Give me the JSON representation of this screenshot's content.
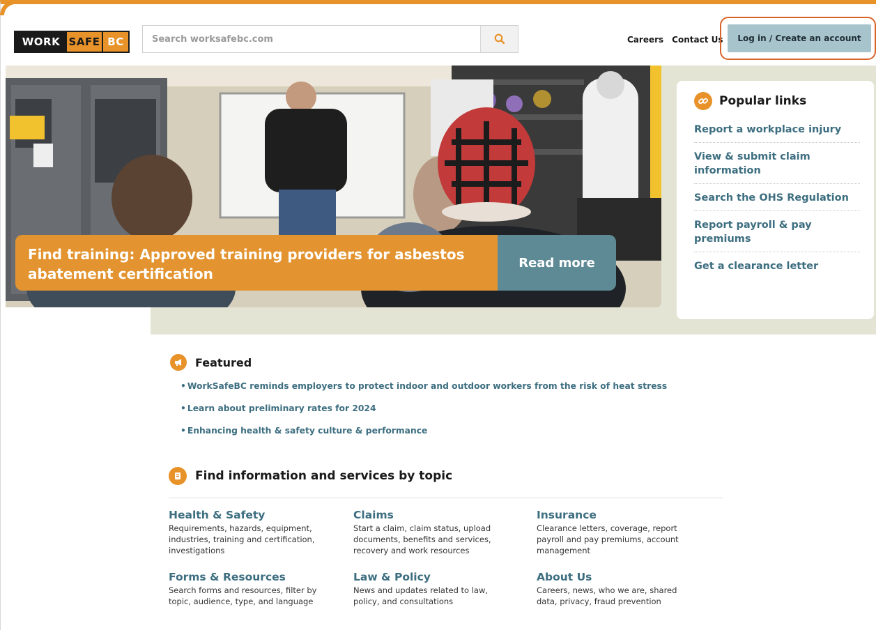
{
  "header": {
    "logo": {
      "work": "WORK",
      "safe": "SAFE",
      "bc": "BC"
    },
    "search_placeholder": "Search worksafebc.com",
    "links": [
      "Careers",
      "Contact Us"
    ],
    "login_label": "Log in / Create an account"
  },
  "hero": {
    "caption": "Find training: Approved training providers for asbestos abatement certification",
    "read_more": "Read more"
  },
  "popular": {
    "title": "Popular links",
    "items": [
      "Report a workplace injury",
      "View & submit claim information",
      "Search the OHS Regulation",
      "Report payroll & pay premiums",
      "Get a clearance letter"
    ]
  },
  "featured": {
    "title": "Featured",
    "items": [
      "WorkSafeBC reminds employers to protect indoor and outdoor workers from the risk of heat stress",
      "Learn about preliminary rates for 2024",
      "Enhancing health & safety culture & performance"
    ]
  },
  "topics": {
    "title": "Find information and services by topic",
    "items": [
      {
        "title": "Health & Safety",
        "desc": "Requirements, hazards, equipment, industries, training and certification, investigations"
      },
      {
        "title": "Claims",
        "desc": "Start a claim, claim status, upload documents, benefits and services, recovery and work resources"
      },
      {
        "title": "Insurance",
        "desc": "Clearance letters, coverage, report payroll and pay premiums, account management"
      },
      {
        "title": "Forms & Resources",
        "desc": "Search forms and resources, filter by topic, audience, type, and language"
      },
      {
        "title": "Law & Policy",
        "desc": "News and updates related to law, policy, and consultations"
      },
      {
        "title": "About Us",
        "desc": "Careers, news, who we are, shared data, privacy, fraud prevention"
      }
    ]
  },
  "colors": {
    "accent": "#e8922a",
    "link": "#3d6e80",
    "button": "#a7c4cc",
    "hero_bg": "#e4e4d5"
  }
}
